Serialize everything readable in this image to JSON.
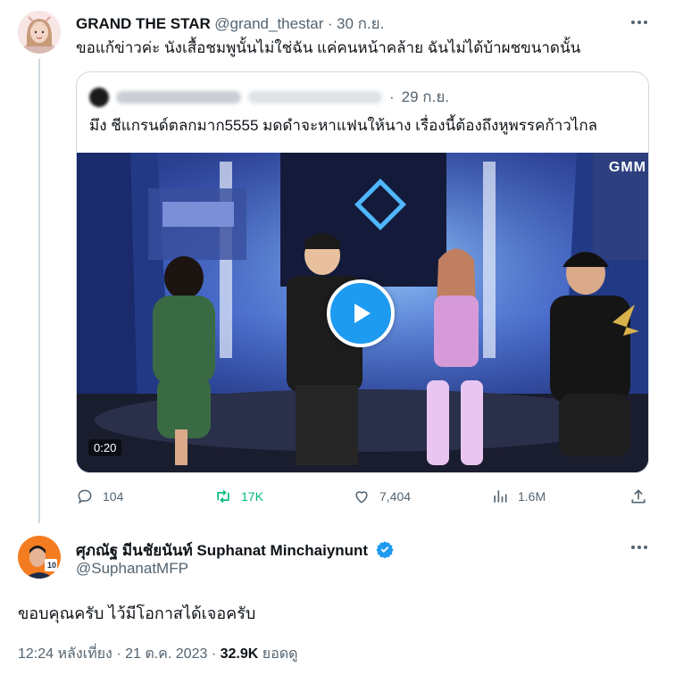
{
  "original_tweet": {
    "display_name": "GRAND THE STAR",
    "handle": "@grand_thestar",
    "separator": "·",
    "date": "30 ก.ย.",
    "text": "ขอแก้ข่าวค่ะ นังเสื้อชมพูนั้นไม่ใช่ฉัน แค่คนหน้าคล้าย ฉันไม่ได้บ้าผชขนาดนั้น"
  },
  "quoted_tweet": {
    "date": "29 ก.ย.",
    "separator": "·",
    "text": "มึง ชีแกรนด์ตลกมาก5555 มดดำจะหาแฟนให้นาง เรื่องนี้ต้องถึงหูพรรคก้าวไกล",
    "video_duration": "0:20",
    "video_logo": "GMM"
  },
  "actions": {
    "replies": "104",
    "retweets": "17K",
    "likes": "7,404",
    "views": "1.6M"
  },
  "reply_tweet": {
    "display_name": "ศุภณัฐ มีนชัยนันท์ Suphanat Minchaiynunt",
    "handle": "@SuphanatMFP",
    "text": "ขอบคุณครับ ไว้มีโอกาสได้เจอครับ",
    "avatar_badge": "10",
    "time": "12:24 หลังเที่ยง",
    "separator1": "·",
    "date": "21 ต.ค. 2023",
    "separator2": "·",
    "views_count": "32.9K",
    "views_label": "ยอดดู"
  },
  "colors": {
    "accent": "#1d9bf0",
    "retweet_active": "#00ba7c",
    "muted_text": "#536471",
    "border": "#cfd9de"
  },
  "icons": [
    "reply-icon",
    "retweet-icon",
    "like-icon",
    "views-icon",
    "share-icon",
    "more-icon",
    "verified-icon",
    "play-icon"
  ]
}
